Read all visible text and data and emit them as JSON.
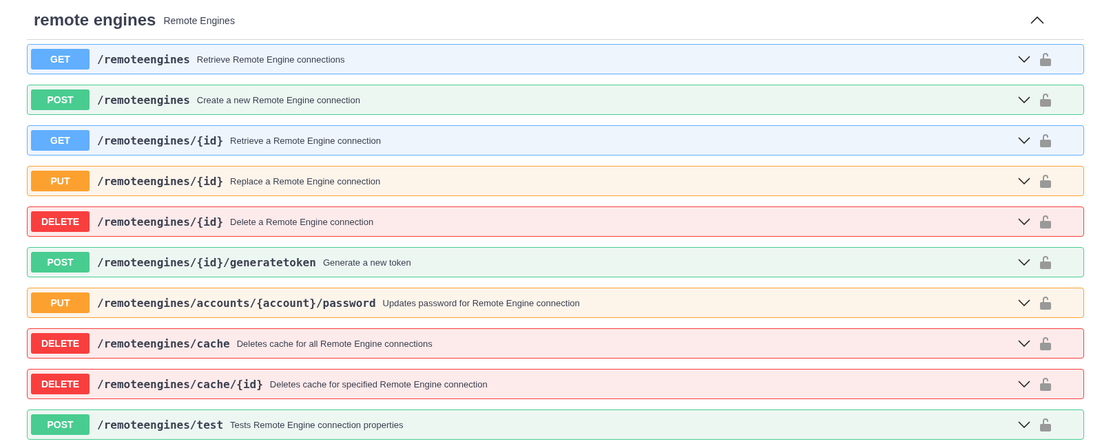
{
  "section": {
    "title": "remote engines",
    "description": "Remote Engines",
    "expanded": true
  },
  "operations": [
    {
      "kind": "get",
      "method": "GET",
      "path": "/remoteengines",
      "summary": "Retrieve Remote Engine connections",
      "expanded": false
    },
    {
      "kind": "post",
      "method": "POST",
      "path": "/remoteengines",
      "summary": "Create a new Remote Engine connection",
      "expanded": false
    },
    {
      "kind": "get",
      "method": "GET",
      "path": "/remoteengines/{id}",
      "summary": "Retrieve a Remote Engine connection",
      "expanded": false
    },
    {
      "kind": "put",
      "method": "PUT",
      "path": "/remoteengines/{id}",
      "summary": "Replace a Remote Engine connection",
      "expanded": false
    },
    {
      "kind": "delete",
      "method": "DELETE",
      "path": "/remoteengines/{id}",
      "summary": "Delete a Remote Engine connection",
      "expanded": false
    },
    {
      "kind": "post",
      "method": "POST",
      "path": "/remoteengines/{id}/generatetoken",
      "summary": "Generate a new token",
      "expanded": false
    },
    {
      "kind": "put",
      "method": "PUT",
      "path": "/remoteengines/accounts/{account}/password",
      "summary": "Updates password for Remote Engine connection",
      "expanded": false
    },
    {
      "kind": "delete",
      "method": "DELETE",
      "path": "/remoteengines/cache",
      "summary": "Deletes cache for all Remote Engine connections",
      "expanded": false
    },
    {
      "kind": "delete",
      "method": "DELETE",
      "path": "/remoteengines/cache/{id}",
      "summary": "Deletes cache for specified Remote Engine connection",
      "expanded": false
    },
    {
      "kind": "post",
      "method": "POST",
      "path": "/remoteengines/test",
      "summary": "Tests Remote Engine connection properties",
      "expanded": false
    }
  ]
}
